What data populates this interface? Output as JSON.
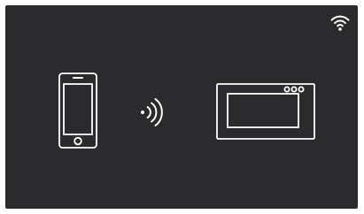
{
  "screen": {
    "background_color": "#2b2b2d",
    "icon_color": "#ffffff"
  },
  "status_bar": {
    "wifi_icon": "wifi-icon"
  },
  "pairing_illustration": {
    "left_device_icon": "smartphone-icon",
    "connection_icon": "wireless-signal-icon",
    "right_device_icon": "indoor-monitor-icon"
  }
}
